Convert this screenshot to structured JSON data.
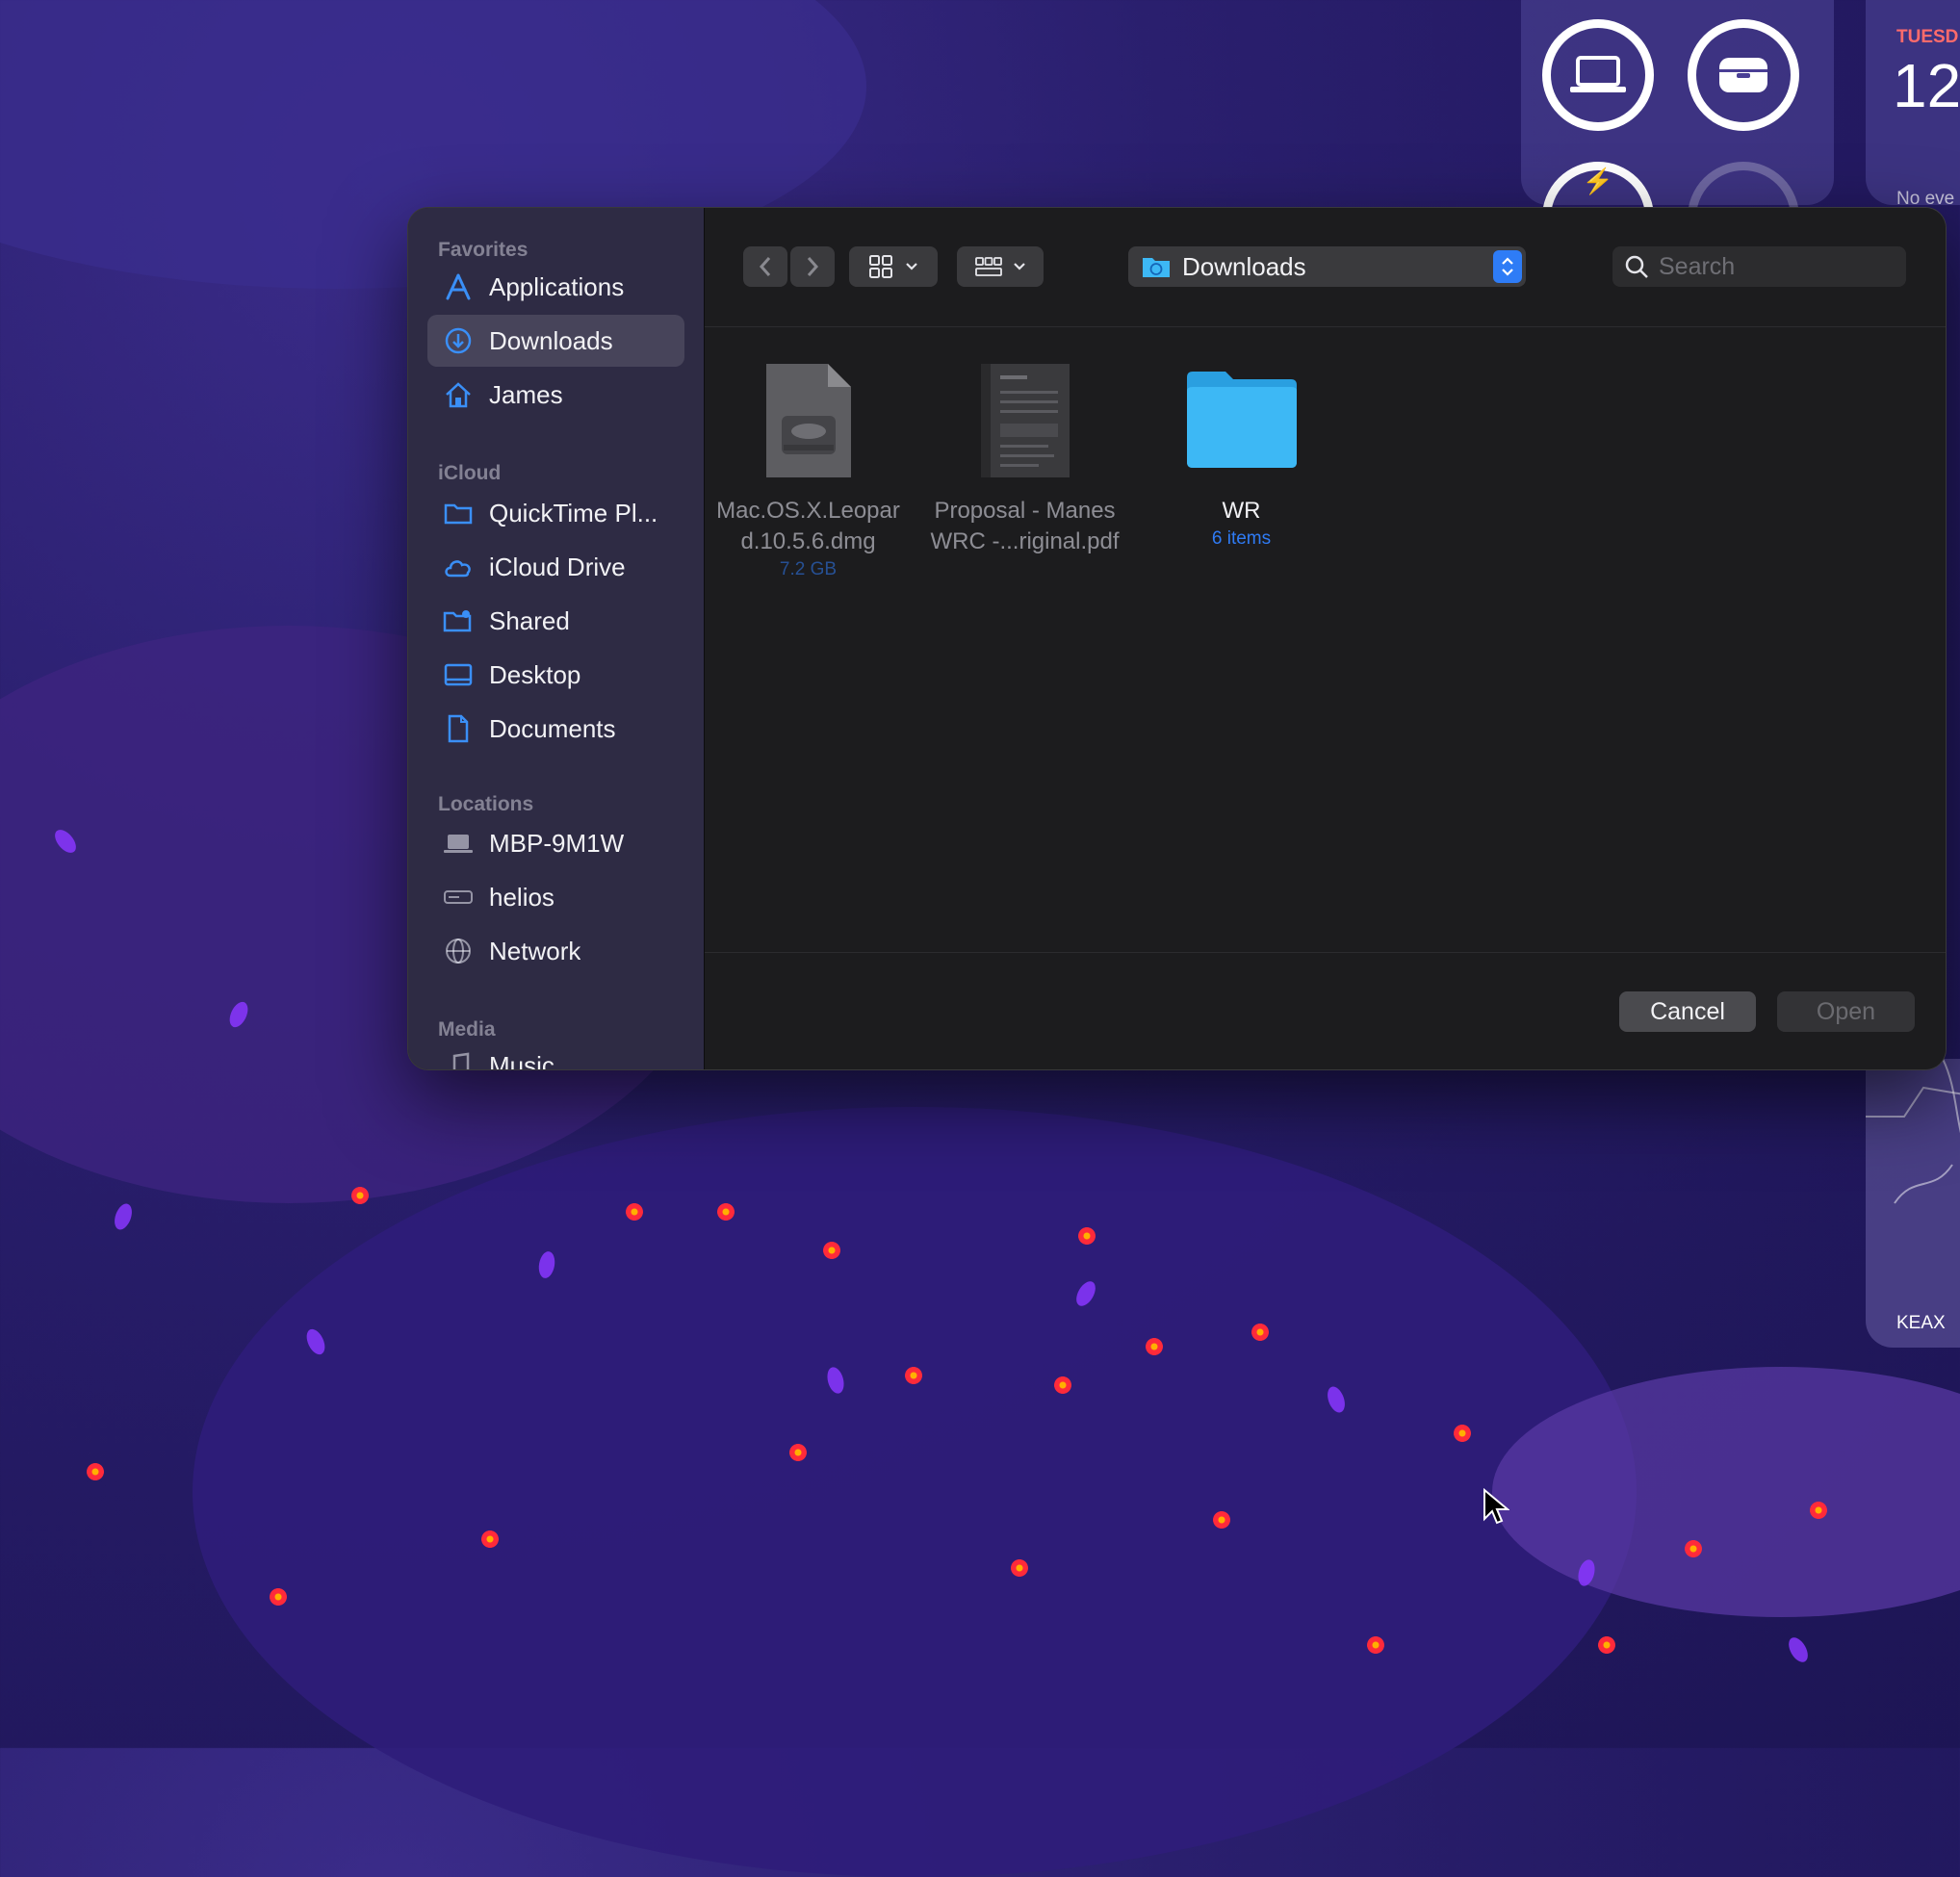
{
  "desktop": {
    "calendar": {
      "day": "TUESD",
      "date": "12",
      "events": "No eve"
    },
    "map_label": "KEAX"
  },
  "sidebar": {
    "sections": [
      {
        "title": "Favorites",
        "items": [
          {
            "label": "Applications",
            "icon": "applications-icon"
          },
          {
            "label": "Downloads",
            "icon": "downloads-icon",
            "selected": true
          },
          {
            "label": "James",
            "icon": "home-icon"
          }
        ]
      },
      {
        "title": "iCloud",
        "items": [
          {
            "label": "QuickTime Pl...",
            "icon": "folder-icon"
          },
          {
            "label": "iCloud Drive",
            "icon": "cloud-icon"
          },
          {
            "label": "Shared",
            "icon": "shared-folder-icon"
          },
          {
            "label": "Desktop",
            "icon": "desktop-icon"
          },
          {
            "label": "Documents",
            "icon": "document-icon"
          }
        ]
      },
      {
        "title": "Locations",
        "items": [
          {
            "label": "MBP-9M1W",
            "icon": "laptop-icon"
          },
          {
            "label": "helios",
            "icon": "drive-icon"
          },
          {
            "label": "Network",
            "icon": "globe-icon"
          }
        ]
      },
      {
        "title": "Media",
        "items": [
          {
            "label": "Music",
            "icon": "music-icon"
          }
        ]
      }
    ]
  },
  "toolbar": {
    "location": "Downloads",
    "search_placeholder": "Search"
  },
  "files": [
    {
      "name_line1": "Mac.OS.X.Leopar",
      "name_line2": "d.10.5.6.dmg",
      "meta": "7.2 GB",
      "type": "disk-image"
    },
    {
      "name_line1": "Proposal - Manes",
      "name_line2": "WRC -...riginal.pdf",
      "meta": "",
      "type": "pdf"
    },
    {
      "name_line1": "WR",
      "name_line2": "",
      "meta": "6 items",
      "type": "folder"
    }
  ],
  "footer": {
    "cancel_label": "Cancel",
    "open_label": "Open"
  },
  "colors": {
    "accent": "#2f7bf5",
    "folder": "#3db8f5",
    "dialog_bg": "#1c1c1e"
  }
}
